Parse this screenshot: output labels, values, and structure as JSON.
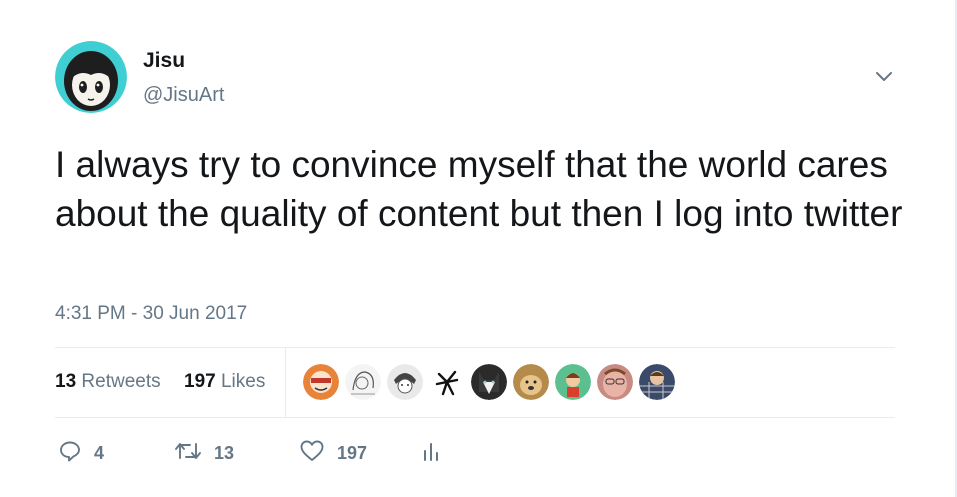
{
  "author": {
    "name": "Jisu",
    "handle": "@JisuArt"
  },
  "tweet": {
    "text": "I always try to convince myself that the world cares about the quality of content but then I log into twitter",
    "timestamp": "4:31 PM - 30 Jun 2017"
  },
  "stats": {
    "retweets_count": "13",
    "retweets_label": "Retweets",
    "likes_count": "197",
    "likes_label": "Likes"
  },
  "liker_avatars": [
    "orange-mask",
    "sketch-girl",
    "sketch-boy",
    "ink-figure",
    "husky",
    "doge",
    "green-kid",
    "pink-face",
    "plaid-man"
  ],
  "actions": {
    "reply_count": "4",
    "retweet_count": "13",
    "like_count": "197"
  },
  "icons": {
    "menu": "chevron-down-icon",
    "reply": "reply-icon",
    "retweet": "retweet-icon",
    "like": "heart-icon",
    "analytics": "analytics-icon"
  },
  "colors": {
    "text": "#14171a",
    "secondary": "#657786",
    "divider": "#e6ecf0",
    "avatar_bg": "#3fcfd3"
  }
}
